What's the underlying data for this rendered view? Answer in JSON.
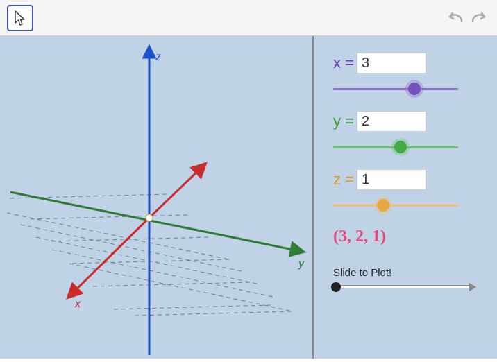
{
  "chart_data": {
    "type": "scatter",
    "title": "",
    "axes": [
      "x",
      "y",
      "z"
    ],
    "point": {
      "x": 3,
      "y": 2,
      "z": 1
    },
    "axis_range": [
      -5,
      5
    ]
  },
  "params": {
    "x": {
      "label": "x =",
      "value": "3",
      "slider_pos": 0.65
    },
    "y": {
      "label": "y =",
      "value": "2",
      "slider_pos": 0.54
    },
    "z": {
      "label": "z =",
      "value": "1",
      "slider_pos": 0.4
    }
  },
  "point_display": "(3, 2, 1)",
  "plot_slider": {
    "label": "Slide to Plot!",
    "pos": 0.02
  },
  "axis_labels": {
    "x": "x",
    "y": "y",
    "z": "z"
  },
  "colors": {
    "x_axis": "#c92a2a",
    "y_axis": "#2e7d32",
    "z_axis": "#1e50c9",
    "grid": "#5a6a7a"
  }
}
